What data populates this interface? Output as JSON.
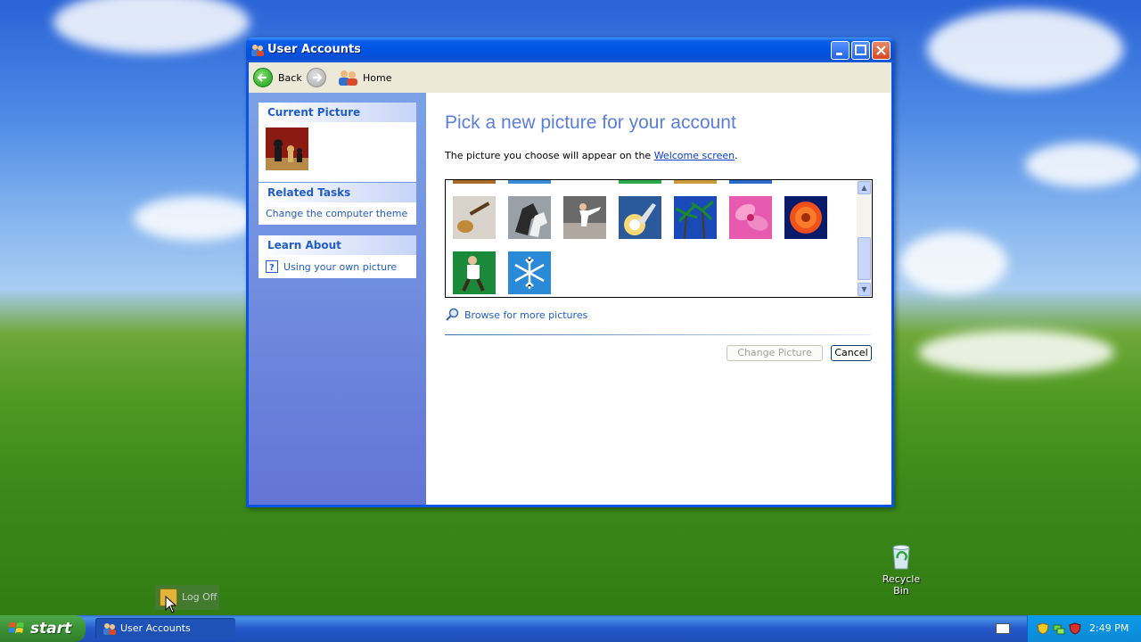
{
  "window": {
    "title": "User Accounts"
  },
  "toolbar": {
    "back_label": "Back",
    "home_label": "Home"
  },
  "sidebar": {
    "current_picture": {
      "heading": "Current Picture"
    },
    "related_tasks": {
      "heading": "Related Tasks",
      "items": [
        {
          "label": "Change the computer theme"
        }
      ]
    },
    "learn_about": {
      "heading": "Learn About",
      "items": [
        {
          "label": "Using your own picture",
          "icon": "help-icon"
        }
      ]
    }
  },
  "main": {
    "title": "Pick a new picture for your account",
    "description_prefix": "The picture you choose will appear on the ",
    "description_link": "Welcome screen",
    "description_suffix": ".",
    "pictures": [
      "guitar",
      "horses",
      "karate",
      "rocket",
      "palm-trees",
      "pink-flower",
      "orange-flower",
      "skater",
      "snowflake"
    ],
    "browse_label": "Browse for more pictures",
    "change_picture_label": "Change Picture",
    "cancel_label": "Cancel"
  },
  "desktop": {
    "recycle_bin_label": "Recycle Bin",
    "log_off_label": "Log Off"
  },
  "taskbar": {
    "start_label": "start",
    "tasks": [
      {
        "label": "User Accounts"
      }
    ],
    "clock": "2:49 PM"
  },
  "colors": {
    "titlebar": "#0054e3",
    "sidebar": "#7ba2e7",
    "title_text": "#5a7edc",
    "link": "#215dc6"
  }
}
